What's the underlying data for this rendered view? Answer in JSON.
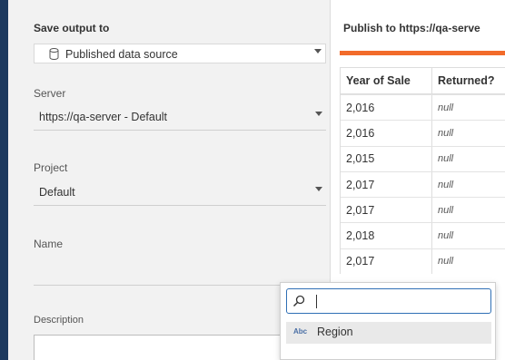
{
  "left": {
    "save_output_label": "Save output to",
    "output_type": {
      "value": "Published data source",
      "icon": "database-icon"
    },
    "server": {
      "label": "Server",
      "value": "https://qa-server - Default"
    },
    "project": {
      "label": "Project",
      "value": "Default"
    },
    "name": {
      "label": "Name",
      "value": ""
    },
    "description": {
      "label": "Description",
      "value": ""
    }
  },
  "right": {
    "publish_title": "Publish to https://qa-serve",
    "accent_color": "#f26b2a",
    "columns": [
      "Year of Sale",
      "Returned?"
    ],
    "rows": [
      [
        "2,016",
        "null"
      ],
      [
        "2,016",
        "null"
      ],
      [
        "2,015",
        "null"
      ],
      [
        "2,017",
        "null"
      ],
      [
        "2,017",
        "null"
      ],
      [
        "2,018",
        "null"
      ],
      [
        "2,017",
        "null"
      ]
    ]
  },
  "popup": {
    "search_value": "",
    "search_placeholder": "",
    "results": [
      {
        "type_icon": "Abc",
        "label": "Region"
      }
    ]
  }
}
